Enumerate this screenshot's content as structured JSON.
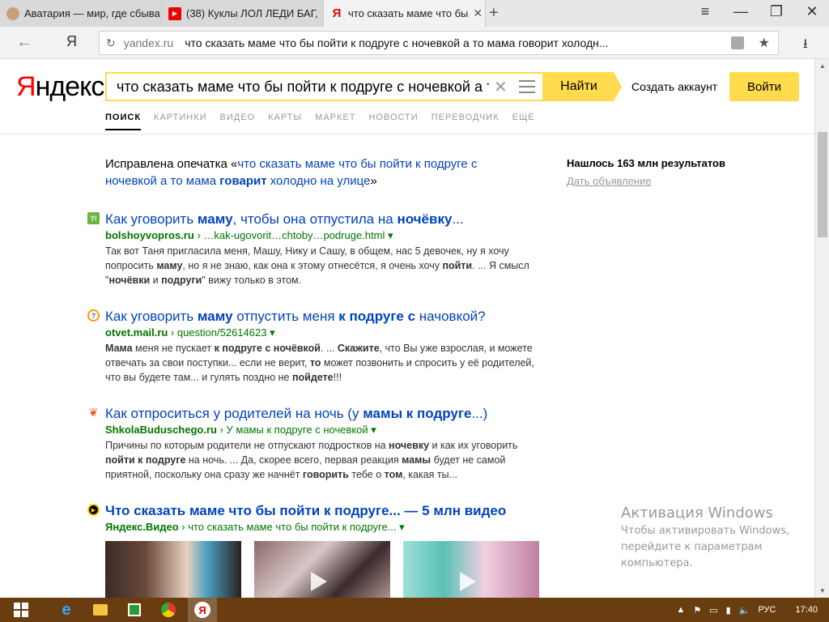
{
  "browser": {
    "tabs": [
      {
        "title": "Аватария — мир, где сбыва",
        "favicon": "avatar-icon",
        "active": false
      },
      {
        "title": "(38) Куклы ЛОЛ ЛЕДИ БАГ,",
        "favicon": "youtube-icon",
        "active": false
      },
      {
        "title": "что сказать маме что бы",
        "favicon": "yandex-icon",
        "active": true
      }
    ],
    "new_tab_glyph": "+",
    "close_glyph": "✕",
    "address": {
      "domain": "yandex.ru",
      "path": "что сказать маме что бы пойти к подруге с ночевкой а то мама говорит холодн..."
    }
  },
  "yandex": {
    "logo_first": "Я",
    "logo_rest": "ндекс",
    "search_value": "что сказать маме что бы пойти к подруге с ночевкой а т",
    "search_button": "Найти",
    "create_account": "Создать аккаунт",
    "login_button": "Войти",
    "nav_tabs": [
      {
        "label": "ПОИСК",
        "active": true
      },
      {
        "label": "КАРТИНКИ",
        "active": false
      },
      {
        "label": "ВИДЕО",
        "active": false
      },
      {
        "label": "КАРТЫ",
        "active": false
      },
      {
        "label": "МАРКЕТ",
        "active": false
      },
      {
        "label": "НОВОСТИ",
        "active": false
      },
      {
        "label": "ПЕРЕВОДЧИК",
        "active": false
      },
      {
        "label": "ЕЩЁ",
        "active": false
      }
    ]
  },
  "misspell": {
    "prefix": "Исправлена опечатка «",
    "query_part1": "что сказать маме что бы пойти к подруге с ночевкой а то мама ",
    "query_bold": "говарит",
    "query_part2": " холодно на улице",
    "suffix": "»"
  },
  "results": [
    {
      "icon": "question-badge-icon",
      "title_html": "Как уговорить <b>маму</b>, чтобы она отпустила на <b>ночёвку</b>...",
      "domain": "bolshoyvopros.ru",
      "path": " › …kak-ugovorit…chtoby…podruge.html ▾",
      "snippet_html": "Так вот Таня пригласила меня, Машу, Нику и Сашу, в общем, нас 5 девочек, ну я хочу попросить <b>маму</b>, но я не знаю, как она к этому отнесётся, я очень хочу <b>пойти</b>. ... Я смысл \"<b>ночёвки</b> и <b>подруги</b>\" вижу только в этом."
    },
    {
      "icon": "answers-mail-icon",
      "title_html": "Как уговорить <b>маму</b> отпустить меня <b>к подруге с</b> начовкой?",
      "domain": "otvet.mail.ru",
      "path": " › question/52614623 ▾",
      "snippet_html": "<b>Мама</b> меня не пускает <b>к подруге с ночёвкой</b>. ... <b>Скажите</b>, что Вы уже взрослая, и можете отвечать за свои поступки... если не верит, <b>то</b> может позвонить и спросить у её родителей, что вы будете там... и гулять поздно не <b>пойдете</b>!!!"
    },
    {
      "icon": "leaf-icon",
      "title_html": "Как отпроситься у родителей на ночь (у <b>мамы к подруге</b>...)",
      "domain": "ShkolaBuduschego.ru",
      "path": " › У мамы к подруге с ночевкой ▾",
      "snippet_html": "Причины по которым родители не отпускают подростков на <b>ночевку</b> и как их уговорить <b>пойти к подруге</b> на ночь. ... Да, скорее всего, первая реакция <b>мамы</b> будет не самой приятной, поскольку она сразу же начнёт <b>говорить</b> тебе о <b>том</b>, какая ты..."
    },
    {
      "icon": "video-play-icon",
      "title_html": "Что сказать маме что бы пойти к подруге... — 5 млн видео",
      "domain": "Яндекс.Видео",
      "path": " › что сказать маме что бы пойти к подруге... ▾",
      "snippet_html": ""
    }
  ],
  "sidebar": {
    "found": "Нашлось 163 млн результатов",
    "ad_link": "Дать объявление"
  },
  "windows_activation": {
    "title": "Активация Windows",
    "body": "Чтобы активировать Windows, перейдите к параметрам компьютера."
  },
  "taskbar": {
    "lang": "РУС",
    "time": "17:40"
  },
  "colors": {
    "accent_yellow": "#ffdb4d",
    "link_blue": "#0044bb",
    "url_green": "#007700",
    "logo_red": "#ff0000",
    "taskbar": "#6a3d10"
  }
}
